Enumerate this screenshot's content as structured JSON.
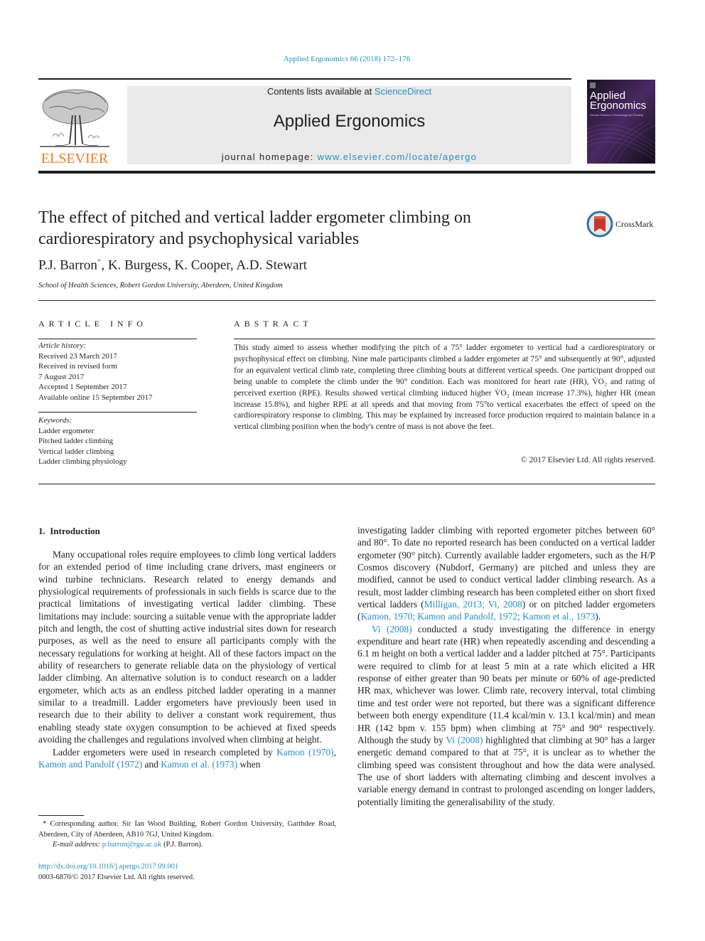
{
  "header": {
    "citation": "Applied Ergonomics 66 (2018) 172–176",
    "contents_prefix": "Contents lists available at ",
    "contents_link": "ScienceDirect",
    "journal_title": "Applied Ergonomics",
    "homepage_prefix": "journal homepage: ",
    "homepage_link": "www.elsevier.com/locate/apergo",
    "publisher_logo_text": "ELSEVIER",
    "cover_title_line1": "Applied",
    "cover_title_line2": "Ergonomics",
    "cover_subtitle": "Human Factors in Technology and Society"
  },
  "article": {
    "title": "The effect of pitched and vertical ladder ergometer climbing on cardiorespiratory and psychophysical variables",
    "crossmark_label": "CrossMark",
    "authors": [
      {
        "name": "P.J. Barron",
        "marker": "*"
      },
      {
        "name": ", K. Burgess, K. Cooper, A.D. Stewart",
        "marker": ""
      }
    ],
    "affiliation": "School of Health Sciences, Robert Gordon University, Aberdeen, United Kingdom"
  },
  "article_info": {
    "heading": "ARTICLE INFO",
    "history_label": "Article history:",
    "history": [
      "Received 23 March 2017",
      "Received in revised form",
      "7 August 2017",
      "Accepted 1 September 2017",
      "Available online 15 September 2017"
    ],
    "keywords_label": "Keywords:",
    "keywords": [
      "Ladder ergometer",
      "Pitched ladder climbing",
      "Vertical ladder climbing",
      "Ladder climbing physiology"
    ]
  },
  "abstract": {
    "heading": "ABSTRACT",
    "text": "This study aimed to assess whether modifying the pitch of a 75° ladder ergometer to vertical had a cardiorespiratory or psychophysical effect on climbing. Nine male participants climbed a ladder ergometer at 75° and subsequently at 90°, adjusted for an equivalent vertical climb rate, completing three climbing bouts at different vertical speeds. One participant dropped out being unable to complete the climb under the 90° condition. Each was monitored for heart rate (HR), V̇O₂ and rating of perceived exertion (RPE). Results showed vertical climbing induced higher V̇O₂ (mean increase 17.3%), higher HR (mean increase 15.8%), and higher RPE at all speeds and that moving from 75°to vertical exacerbates the effect of speed on the cardiorespiratory response to climbing. This may be explained by increased force production required to maintain balance in a vertical climbing position when the body's centre of mass is not above the feet.",
    "copyright": "© 2017 Elsevier Ltd. All rights reserved."
  },
  "body": {
    "section_heading": "1.  Introduction",
    "left_p1": "Many occupational roles require employees to climb long vertical ladders for an extended period of time including crane drivers, mast engineers or wind turbine technicians. Research related to energy demands and physiological requirements of professionals in such fields is scarce due to the practical limitations of investigating vertical ladder climbing. These limitations may include: sourcing a suitable venue with the appropriate ladder pitch and length, the cost of shutting active industrial sites down for research purposes, as well as the need to ensure all participants comply with the necessary regulations for working at height. All of these factors impact on the ability of researchers to generate reliable data on the physiology of vertical ladder climbing. An alternative solution is to conduct research on a ladder ergometer, which acts as an endless pitched ladder operating in a manner similar to a treadmill. Ladder ergometers have previously been used in research due to their ability to deliver a constant work requirement, thus enabling steady state oxygen consumption to be achieved at fixed speeds avoiding the challenges and regulations involved when climbing at height.",
    "left_p2_a": "Ladder ergometers were used in research completed by ",
    "left_p2_link1": "Kamon (1970)",
    "left_p2_b": ", ",
    "left_p2_link2": "Kamon and Pandolf (1972)",
    "left_p2_c": " and ",
    "left_p2_link3": "Kamon et al. (1973)",
    "left_p2_d": " when",
    "right_p1_a": "investigating ladder climbing with reported ergometer pitches between 60° and 80°. To date no reported research has been conducted on a vertical ladder ergometer (90° pitch). Currently available ladder ergometers, such as the H/P Cosmos discovery (Nubdorf, Germany) are pitched and unless they are modified, cannot be used to conduct vertical ladder climbing research. As a result, most ladder climbing research has been completed either on short fixed vertical ladders (",
    "right_p1_link1": "Milligan, 2013; Vi, 2008",
    "right_p1_b": ") or on pitched ladder ergometers (",
    "right_p1_link2": "Kamon, 1970; Kamon and Pandolf, 1972; Kamon et al., 1973",
    "right_p1_c": ").",
    "right_p2_link1": "Vi (2008)",
    "right_p2_a": " conducted a study investigating the difference in energy expenditure and heart rate (HR) when repeatedly ascending and descending a 6.1 m height on both a vertical ladder and a ladder pitched at 75°. Participants were required to climb for at least 5 min at a rate which elicited a HR response of either greater than 90 beats per minute or 60% of age-predicted HR max, whichever was lower. Climb rate, recovery interval, total climbing time and test order were not reported, but there was a significant difference between both energy expenditure (11.4 kcal/min v. 13.1 kcal/min) and mean HR (142 bpm v. 155 bpm) when climbing at 75° and 90° respectively. Although the study by ",
    "right_p2_link2": "Vi (2008)",
    "right_p2_b": " highlighted that climbing at 90° has a larger energetic demand compared to that at 75°, it is unclear as to whether the climbing speed was consistent throughout and how the data were analysed. The use of short ladders with alternating climbing and descent involves a variable energy demand in contrast to prolonged ascending on longer ladders, potentially limiting the generalisability of the study."
  },
  "footnote": {
    "corresponding": "* Corresponding author. Sir Ian Wood Building, Robert Gordon University, Garthdee Road, Aberdeen, City of Aberdeen, AB10 7GJ, United Kingdom.",
    "email_label": "E-mail address: ",
    "email": "p.barron@rgu.ac.uk",
    "email_suffix": " (P.J. Barron).",
    "doi": "http://dx.doi.org/10.1016/j.apergo.2017.09.001",
    "issn_copyright": "0003-6870/© 2017 Elsevier Ltd. All rights reserved."
  },
  "colors": {
    "link": "#2a8ec1",
    "elsevier_orange": "#f07a1e",
    "masthead_bg": "#e9e9e9",
    "text": "#231f20"
  }
}
